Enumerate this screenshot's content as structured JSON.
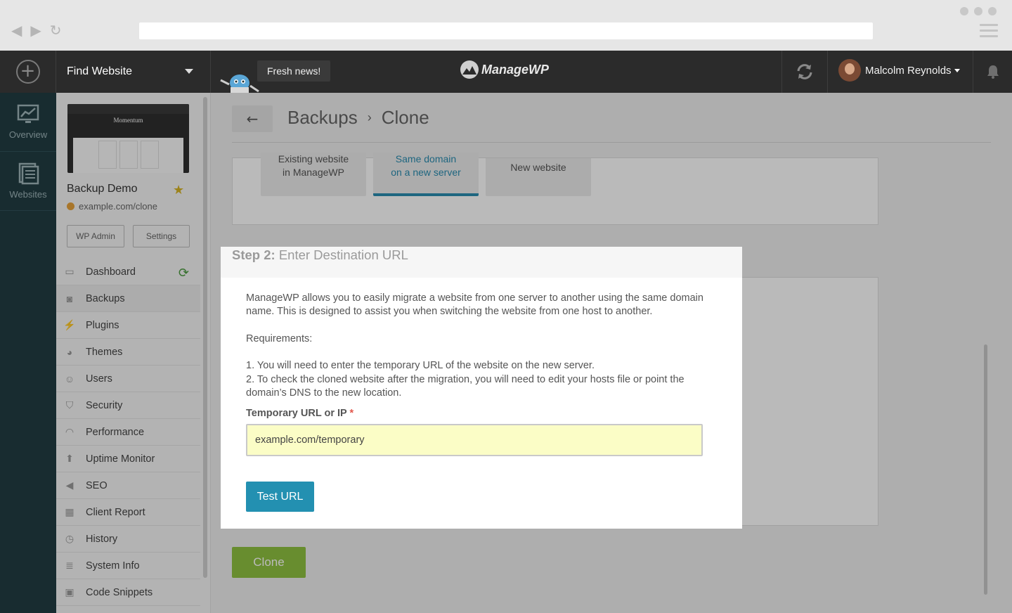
{
  "browser": {
    "nav_back_glyph": "◀",
    "nav_forward_glyph": "▶",
    "nav_reload_glyph": "↻"
  },
  "topbar": {
    "find_website": "Find Website",
    "news": "Fresh news!",
    "logo_text": "ManageWP",
    "user_name": "Malcolm Reynolds"
  },
  "rail": {
    "items": [
      {
        "label": "Overview",
        "icon": "chart-monitor-icon"
      },
      {
        "label": "Websites",
        "icon": "websites-list-icon"
      }
    ]
  },
  "site": {
    "thumb_title": "Momentum",
    "name": "Backup Demo",
    "url": "example.com/clone",
    "wp_admin": "WP Admin",
    "settings": "Settings"
  },
  "menu": {
    "items": [
      {
        "label": "Dashboard",
        "icon": "monitor-icon"
      },
      {
        "label": "Backups",
        "icon": "backup-drive-icon"
      },
      {
        "label": "Plugins",
        "icon": "plug-icon"
      },
      {
        "label": "Themes",
        "icon": "palette-icon"
      },
      {
        "label": "Users",
        "icon": "user-icon"
      },
      {
        "label": "Security",
        "icon": "shield-icon"
      },
      {
        "label": "Performance",
        "icon": "gauge-icon"
      },
      {
        "label": "Uptime Monitor",
        "icon": "arrow-up-icon"
      },
      {
        "label": "SEO",
        "icon": "megaphone-icon"
      },
      {
        "label": "Client Report",
        "icon": "report-chart-icon"
      },
      {
        "label": "History",
        "icon": "clock-icon"
      },
      {
        "label": "System Info",
        "icon": "server-icon"
      },
      {
        "label": "Code Snippets",
        "icon": "code-icon"
      }
    ],
    "active": "Backups"
  },
  "main": {
    "back_glyph": "←",
    "breadcrumb": [
      "Backups",
      "Clone"
    ],
    "breadcrumb_sep": "›",
    "options": [
      {
        "line1": "Existing website",
        "line2": "in ManageWP"
      },
      {
        "line1": "Same domain",
        "line2": "on a new server"
      },
      {
        "line1": "New website",
        "line2": ""
      }
    ],
    "selected_option": "Same domain on a new server",
    "clone_button": "Clone"
  },
  "step": {
    "number": "Step 2:",
    "title": "Enter Destination URL",
    "intro": "ManageWP allows you to easily migrate a website from one server to another using the same domain name. This is designed to assist you when switching the website from one host to another.",
    "requirements_heading": "Requirements:",
    "req1": "1. You will need to enter the temporary URL of the website on the new server.",
    "req2": "2. To check the cloned website after the migration, you will need to edit your hosts file or point the domain’s DNS to the new location.",
    "field_label": "Temporary URL or IP",
    "required_mark": "*",
    "field_value": "example.com/temporary",
    "test_button": "Test URL"
  },
  "colors": {
    "topbar_bg": "#2b2b2b",
    "rail_bg": "#213d42",
    "accent_blue": "#2390b1",
    "clone_green": "#8fc241",
    "input_highlight": "#fbfdc6",
    "required_red": "#e2574c"
  }
}
